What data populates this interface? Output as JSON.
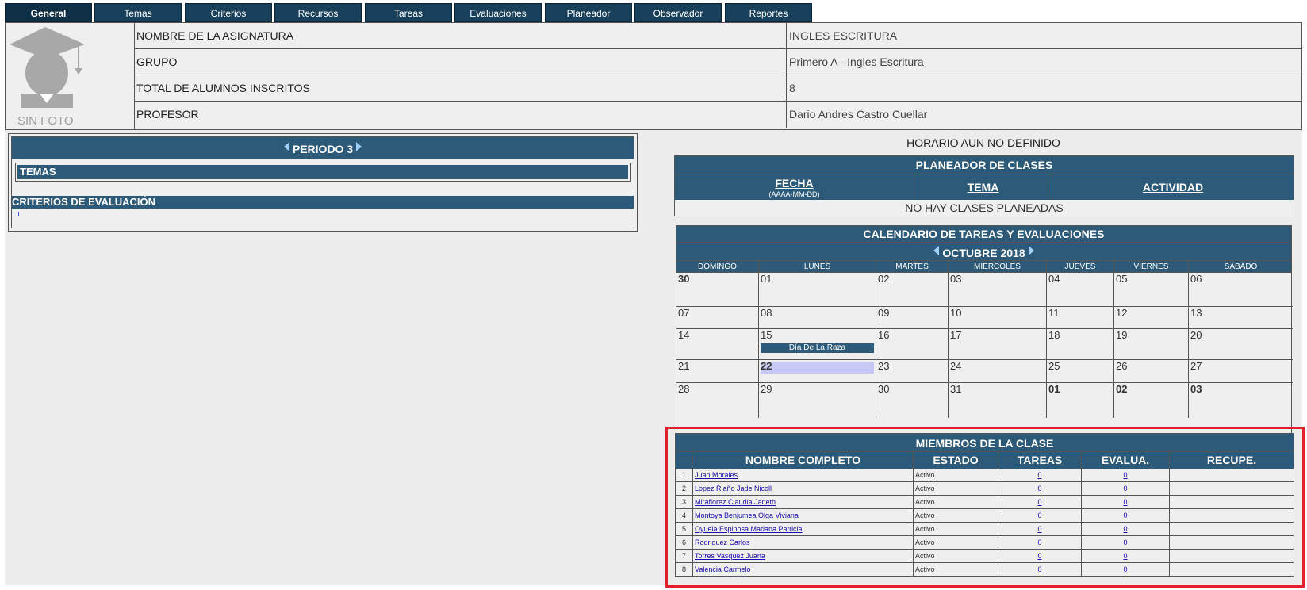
{
  "tabs": [
    "General",
    "Temas",
    "Criterios",
    "Recursos",
    "Tareas",
    "Evaluaciones",
    "Planeador",
    "Observador",
    "Reportes"
  ],
  "info": {
    "photo_label": "SIN FOTO",
    "rows": [
      {
        "label": "NOMBRE DE LA ASIGNATURA",
        "value": "INGLES ESCRITURA"
      },
      {
        "label": "GRUPO",
        "value": "Primero A - Ingles Escritura"
      },
      {
        "label": "TOTAL DE ALUMNOS INSCRITOS",
        "value": "8"
      },
      {
        "label": "PROFESOR",
        "value": "Dario Andres Castro Cuellar"
      }
    ]
  },
  "left": {
    "periodo": "PERIODO 3",
    "temas": "TEMAS",
    "criterios": "CRITERIOS DE EVALUACIÓN"
  },
  "horario": "HORARIO AUN NO DEFINIDO",
  "planeador": {
    "title": "PLANEADOR DE CLASES",
    "fecha": "FECHA",
    "fecha_sub": "(AAAA-MM-DD)",
    "tema": "TEMA",
    "actividad": "ACTIVIDAD",
    "empty": "NO HAY CLASES PLANEADAS"
  },
  "calendar": {
    "title": "CALENDARIO DE TAREAS Y EVALUACIONES",
    "month": "OCTUBRE 2018",
    "days": [
      "DOMINGO",
      "LUNES",
      "MARTES",
      "MIERCOLES",
      "JUEVES",
      "VIERNES",
      "SABADO"
    ],
    "weeks": [
      [
        "30",
        "01",
        "02",
        "03",
        "04",
        "05",
        "06"
      ],
      [
        "07",
        "08",
        "09",
        "10",
        "11",
        "12",
        "13"
      ],
      [
        "14",
        "15",
        "16",
        "17",
        "18",
        "19",
        "20"
      ],
      [
        "21",
        "22",
        "23",
        "24",
        "25",
        "26",
        "27"
      ],
      [
        "28",
        "29",
        "30",
        "31",
        "01",
        "02",
        "03"
      ]
    ],
    "event": "Día De La Raza"
  },
  "members": {
    "title": "MIEMBROS DE LA CLASE",
    "headers": {
      "nombre": "NOMBRE COMPLETO",
      "estado": "ESTADO",
      "tareas": "TAREAS",
      "evalua": "EVALUA.",
      "recupe": "RECUPE."
    },
    "rows": [
      {
        "n": "1",
        "name": "Juan Morales",
        "estado": "Activo",
        "tareas": "0",
        "evalua": "0"
      },
      {
        "n": "2",
        "name": "Lopez Riaño Jade Nicoll",
        "estado": "Activo",
        "tareas": "0",
        "evalua": "0"
      },
      {
        "n": "3",
        "name": "Miraflorez Claudia Janeth",
        "estado": "Activo",
        "tareas": "0",
        "evalua": "0"
      },
      {
        "n": "4",
        "name": "Montoya Benjumea Olga Viviana",
        "estado": "Activo",
        "tareas": "0",
        "evalua": "0"
      },
      {
        "n": "5",
        "name": "Oyuela Espinosa Mariana Patricia",
        "estado": "Activo",
        "tareas": "0",
        "evalua": "0"
      },
      {
        "n": "6",
        "name": "Rodriguez Carlos",
        "estado": "Activo",
        "tareas": "0",
        "evalua": "0"
      },
      {
        "n": "7",
        "name": "Torres Vasquez Juana",
        "estado": "Activo",
        "tareas": "0",
        "evalua": "0"
      },
      {
        "n": "8",
        "name": "Valencia Carmelo",
        "estado": "Activo",
        "tareas": "0",
        "evalua": "0"
      }
    ]
  }
}
